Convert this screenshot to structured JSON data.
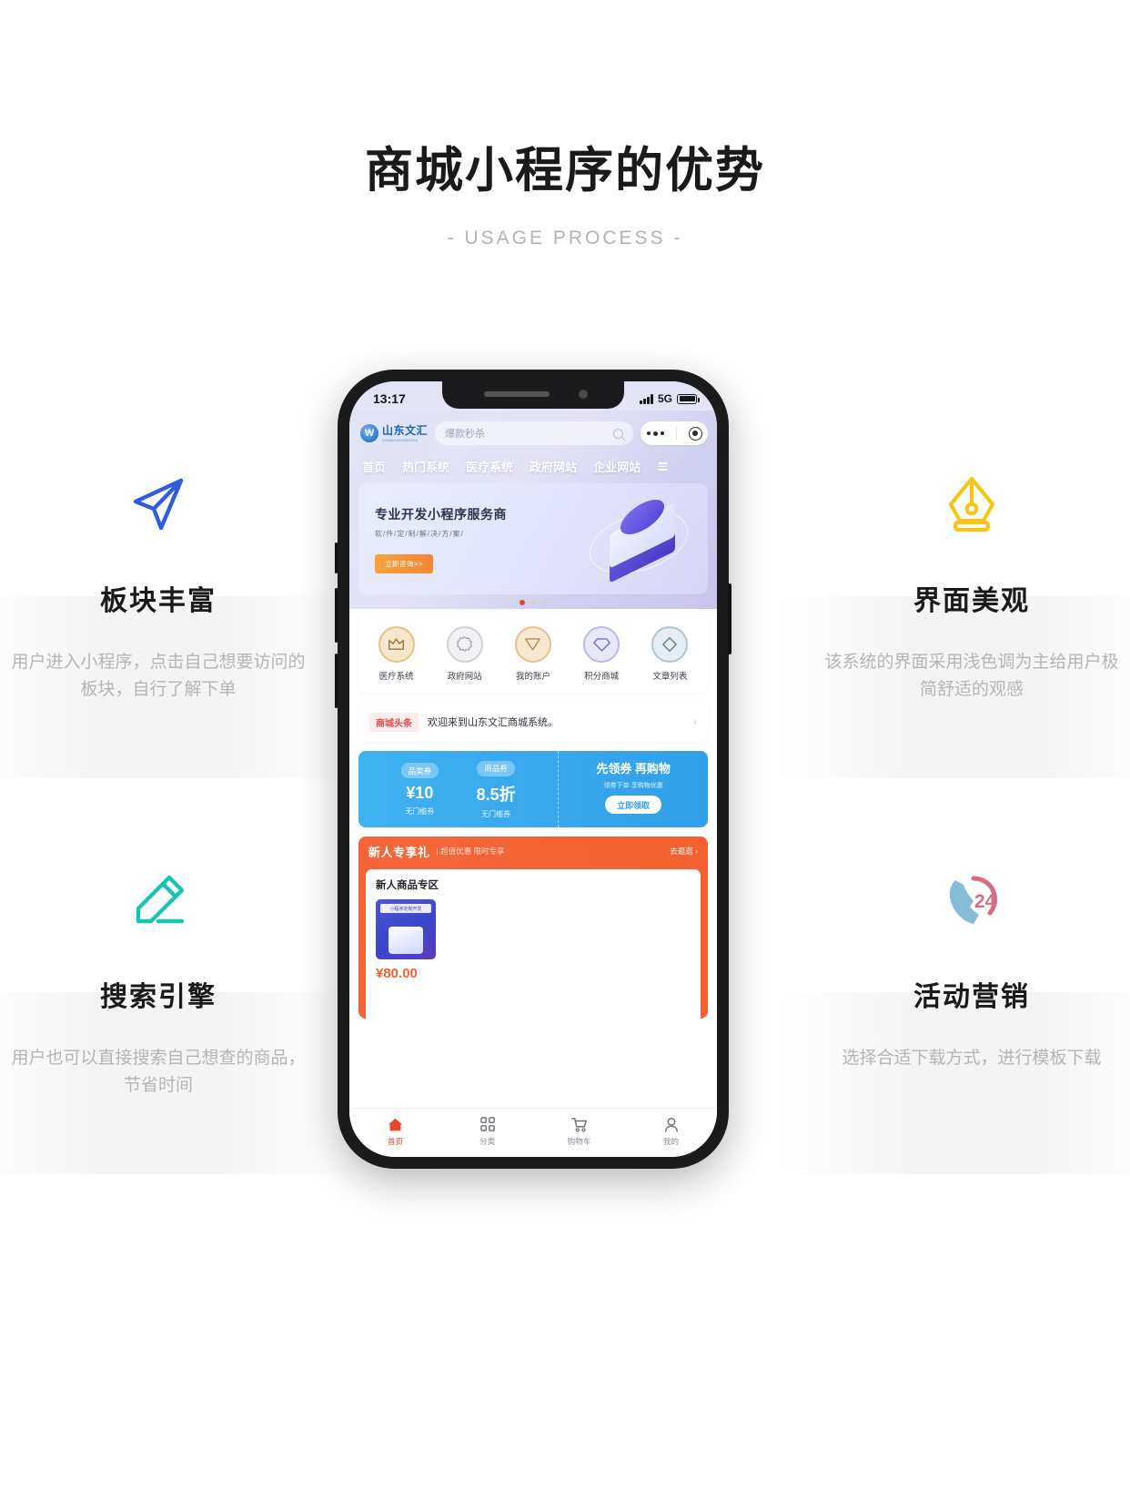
{
  "header": {
    "title": "商城小程序的优势",
    "subtitle": "- USAGE PROCESS -"
  },
  "features": [
    {
      "icon": "send-plane-icon",
      "color": "#2f5bdd",
      "title": "板块丰富",
      "desc": "用户进入小程序，点击自己想要访问的板块，自行了解下单"
    },
    {
      "icon": "pen-nib-icon",
      "color": "#f6c519",
      "title": "界面美观",
      "desc": "该系统的界面采用浅色调为主给用户极简舒适的观感"
    },
    {
      "icon": "pencil-edit-icon",
      "color": "#16c3b4",
      "title": "搜索引擎",
      "desc": "用户也可以直接搜索自己想查的商品，节省时间"
    },
    {
      "icon": "phone-24h-support-icon",
      "color": "#7fb8d6",
      "title": "活动营销",
      "desc": "选择合适下载方式，进行模板下载"
    }
  ],
  "phone": {
    "status": {
      "time": "13:17",
      "network": "5G"
    },
    "app": {
      "brand_cn": "山东文汇",
      "brand_en": "SHANDONGWENHUI",
      "search_placeholder": "爆款秒杀",
      "nav": [
        "首页",
        "热门系统",
        "医疗系统",
        "政府网站",
        "企业网站"
      ],
      "banner": {
        "title": "专业开发小程序服务商",
        "subtitle": "软/件/定/制/解/决/方/案/",
        "button": "立即咨询>>",
        "dots": 3,
        "active_dot": 1
      },
      "quick_entries": [
        {
          "label": "医疗系统",
          "glyph": "crown-icon",
          "color": "#e2b06a"
        },
        {
          "label": "政府网站",
          "glyph": "gear-flower-icon",
          "color": "#b9bcc6"
        },
        {
          "label": "我的账户",
          "glyph": "triangle-down-icon",
          "color": "#e3b98a"
        },
        {
          "label": "积分商城",
          "glyph": "gem-icon",
          "color": "#8e8de0"
        },
        {
          "label": "文章列表",
          "glyph": "diamond-icon",
          "color": "#8fa9bd"
        }
      ],
      "news": {
        "tag": "商城头条",
        "text": "欢迎来到山东文汇商城系统。",
        "arrow": "›"
      },
      "coupons": {
        "items": [
          {
            "type": "品类券",
            "value": "¥10",
            "note": "无门槛券"
          },
          {
            "type": "商品券",
            "value": "8.5折",
            "note": "无门槛券"
          }
        ],
        "headline": "先领券 再购物",
        "sub": "领券下单·享购物优惠",
        "button": "立即领取"
      },
      "newbie": {
        "title": "新人专享礼",
        "sub": "| 超值优惠 限时专享",
        "go": "去逛逛 ›",
        "zone": "新人商品专区",
        "product_caption": "小程序定制开发",
        "price": "¥80.00"
      },
      "tabbar": [
        {
          "label": "首页",
          "icon": "home-icon",
          "active": true
        },
        {
          "label": "分类",
          "icon": "grid-icon",
          "active": false
        },
        {
          "label": "购物车",
          "icon": "cart-icon",
          "active": false
        },
        {
          "label": "我的",
          "icon": "user-icon",
          "active": false
        }
      ]
    }
  }
}
